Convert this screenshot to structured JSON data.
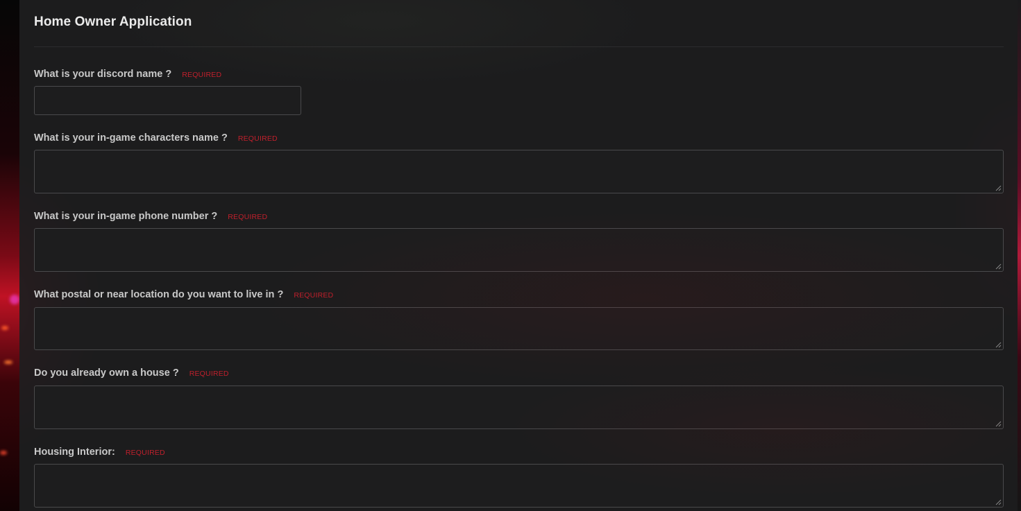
{
  "form": {
    "title": "Home Owner Application",
    "required_text": "REQUIRED",
    "fields": [
      {
        "label": "What is your discord name ?",
        "value": "",
        "kind": "input"
      },
      {
        "label": "What is your in-game characters name ?",
        "value": "",
        "kind": "textarea"
      },
      {
        "label": "What is your in-game phone number ?",
        "value": "",
        "kind": "textarea"
      },
      {
        "label": "What postal or near location do you want to live in ?",
        "value": "",
        "kind": "textarea"
      },
      {
        "label": "Do you already own a house ?",
        "value": "",
        "kind": "textarea"
      },
      {
        "label": "Housing Interior:",
        "value": "",
        "kind": "textarea"
      }
    ]
  },
  "colors": {
    "panel": "#1e1e1f",
    "required": "#c0202c",
    "label": "#c9c9c9",
    "title": "#ececec",
    "field_border": "#4a4a4c"
  },
  "icons": {
    "resize": "resize-grip-icon"
  }
}
